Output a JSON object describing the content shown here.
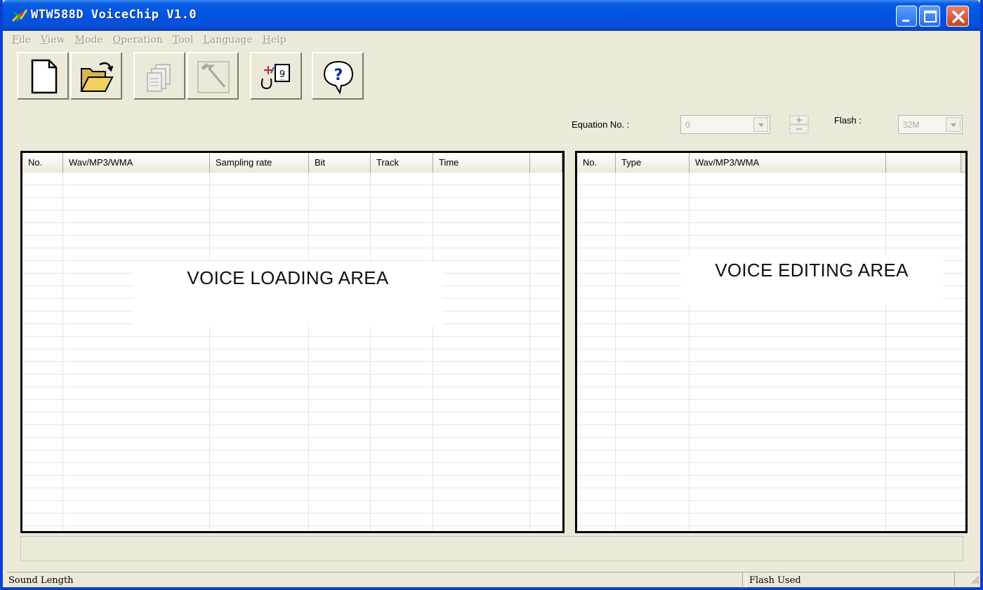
{
  "window": {
    "title": "WTW588D VoiceChip V1.0",
    "accent_color": "#0054e3",
    "close_color": "#c84123"
  },
  "menu": [
    {
      "label": "File",
      "mnemonic": "F",
      "rest": "ile"
    },
    {
      "label": "View",
      "mnemonic": "V",
      "rest": "iew"
    },
    {
      "label": "Mode",
      "mnemonic": "M",
      "rest": "ode"
    },
    {
      "label": "Operation",
      "mnemonic": "O",
      "rest": "peration"
    },
    {
      "label": "Tool",
      "mnemonic": "T",
      "rest": "ool"
    },
    {
      "label": "Language",
      "mnemonic": "L",
      "rest": "anguage"
    },
    {
      "label": "Help",
      "mnemonic": "H",
      "rest": "elp"
    }
  ],
  "toolbar": {
    "buttons": [
      {
        "icon": "new-file-icon",
        "enabled": true
      },
      {
        "icon": "open-folder-icon",
        "enabled": true
      },
      {
        "icon": "files-stack-icon",
        "enabled": false
      },
      {
        "icon": "hammer-icon",
        "enabled": false
      },
      {
        "icon": "equation-icon",
        "enabled": true
      },
      {
        "icon": "help-icon",
        "enabled": true
      }
    ]
  },
  "controls": {
    "equation_label": "Equation No. :",
    "equation_value": "0",
    "flash_label": "Flash :",
    "flash_value": "32M"
  },
  "loading_panel": {
    "columns": [
      "No.",
      "Wav/MP3/WMA",
      "Sampling rate",
      "Bit",
      "Track",
      "Time",
      ""
    ],
    "overlay_text": "VOICE LOADING AREA"
  },
  "editing_panel": {
    "columns": [
      "No.",
      "Type",
      "Wav/MP3/WMA",
      ""
    ],
    "overlay_text": "VOICE EDITING AREA"
  },
  "status": {
    "left": "Sound Length",
    "right": "Flash Used"
  }
}
